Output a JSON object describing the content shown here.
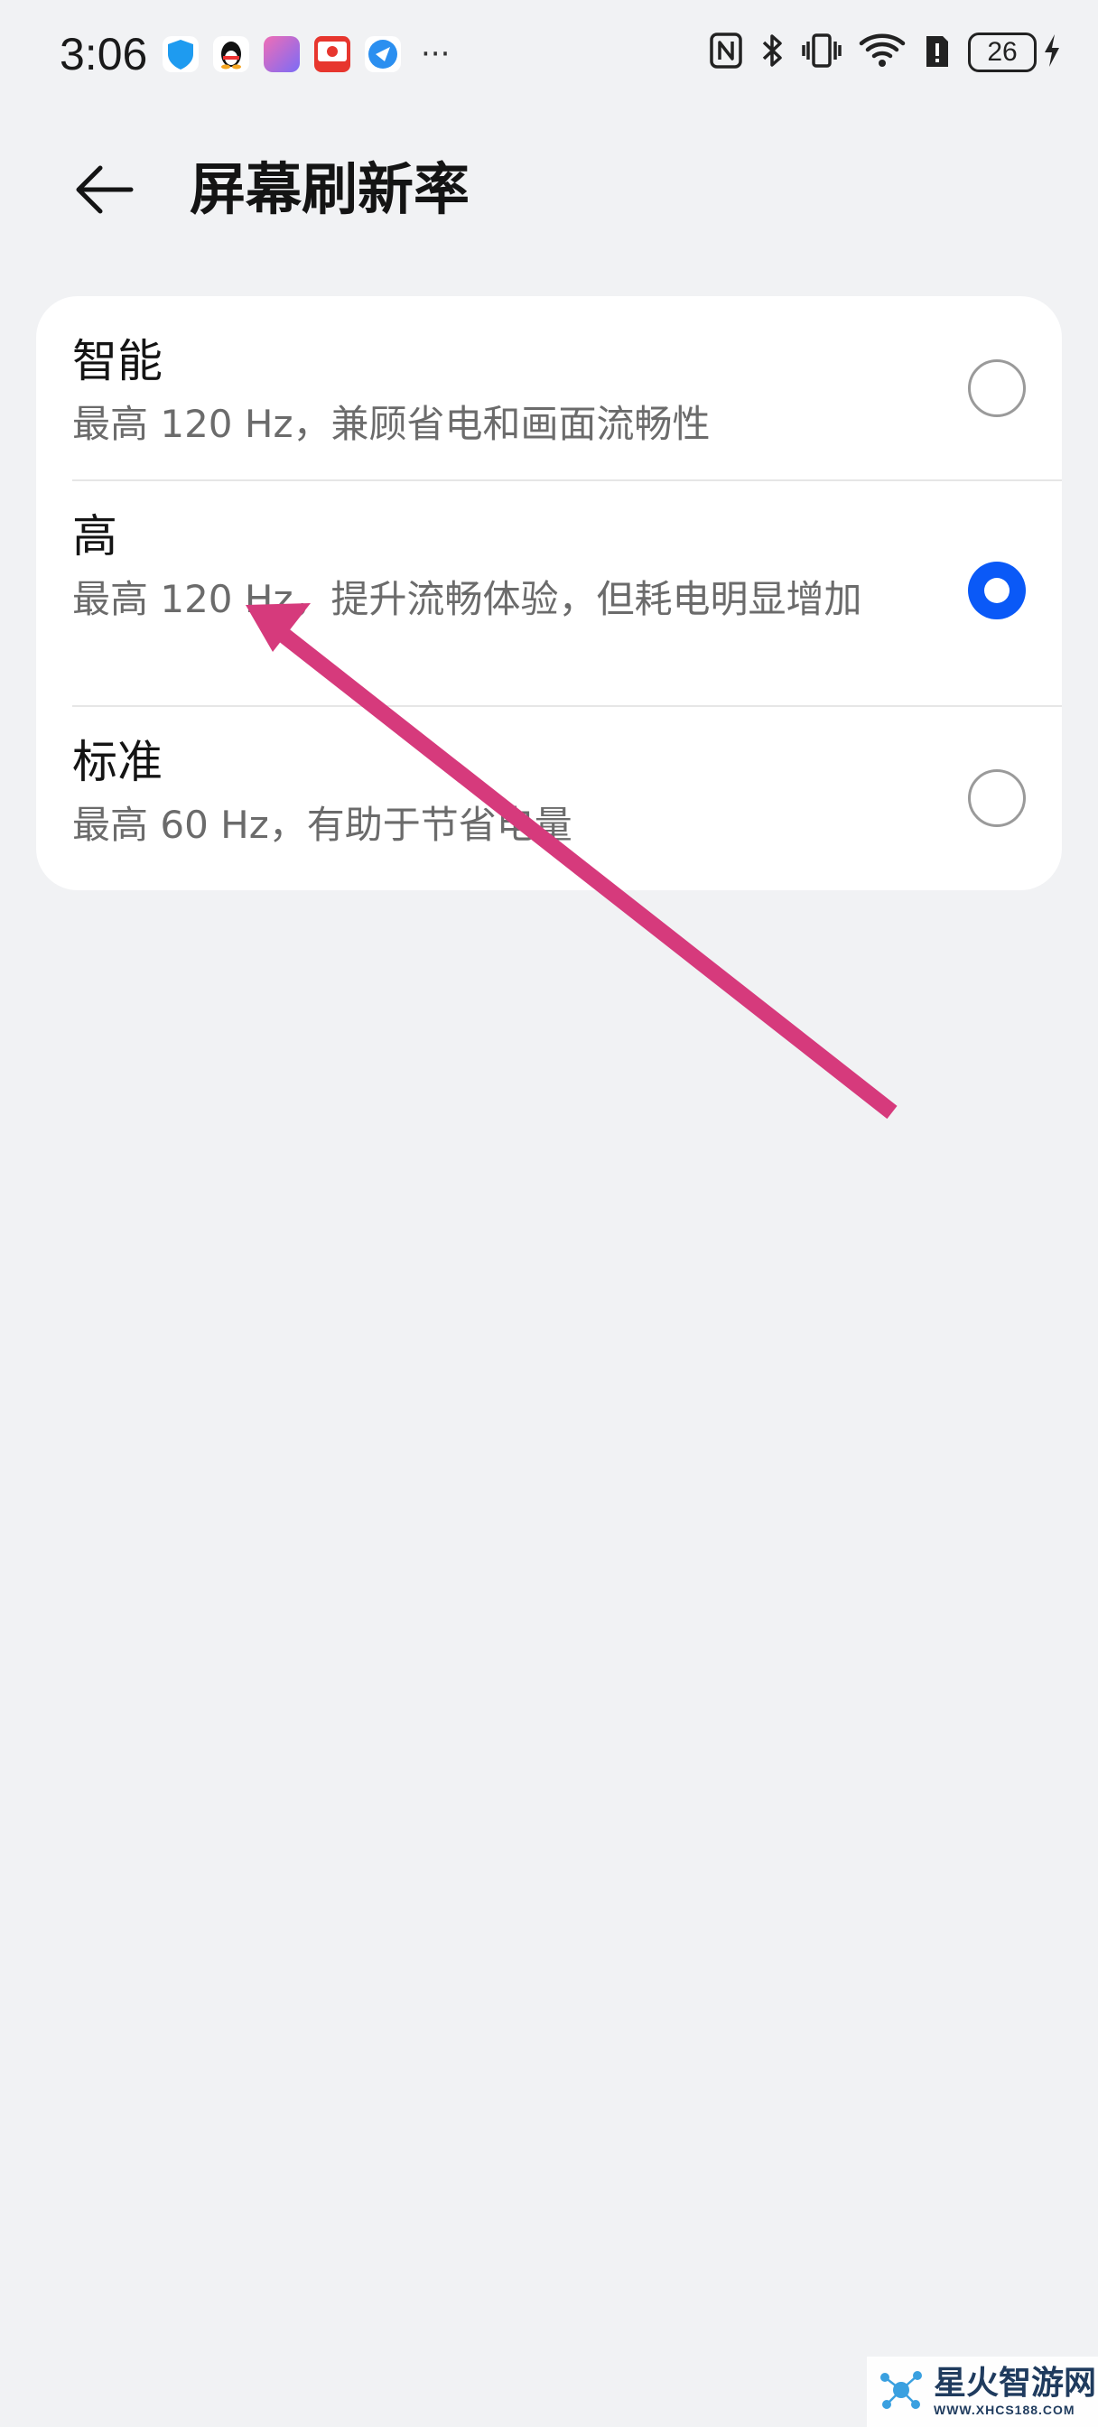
{
  "status_bar": {
    "time": "3:06",
    "notification_icons": [
      "shield-app-icon",
      "qq-icon",
      "app-icon",
      "calendar-app-icon",
      "browser-icon"
    ],
    "more": "···",
    "system_icons": [
      "nfc-icon",
      "bluetooth-icon",
      "vibrate-icon",
      "wifi-icon",
      "sim-alert-icon"
    ],
    "battery_level": "26"
  },
  "header": {
    "back_icon": "arrow-left-icon",
    "title": "屏幕刷新率"
  },
  "options": [
    {
      "title": "智能",
      "description": "最高 120 Hz，兼顾省电和画面流畅性",
      "selected": false
    },
    {
      "title": "高",
      "description": "最高 120 Hz，提升流畅体验，但耗电明显增加",
      "selected": true
    },
    {
      "title": "标准",
      "description": "最高 60 Hz，有助于节省电量",
      "selected": false
    }
  ],
  "colors": {
    "background": "#f1f2f4",
    "card": "#ffffff",
    "accent": "#0a59f7",
    "annotation_arrow": "#d63a7c"
  },
  "watermark": {
    "name": "星火智游网",
    "url": "WWW.XHCS188.COM"
  }
}
